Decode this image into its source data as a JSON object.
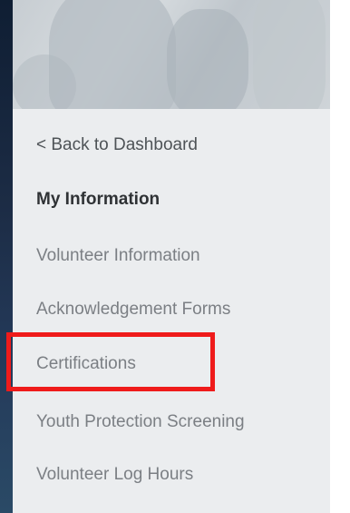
{
  "sidebar": {
    "back_link": "< Back to Dashboard",
    "section_title": "My Information",
    "items": [
      {
        "label": "Volunteer Information"
      },
      {
        "label": "Acknowledgement Forms"
      },
      {
        "label": "Certifications"
      },
      {
        "label": "Youth Protection Screening"
      },
      {
        "label": "Volunteer Log Hours"
      }
    ]
  },
  "annotation": {
    "highlight_color": "#ef1b1b",
    "highlighted_item": "Certifications"
  },
  "colors": {
    "panel_background": "#ebedef",
    "item_text": "#7b7f84",
    "section_title_text": "#2f3235"
  }
}
